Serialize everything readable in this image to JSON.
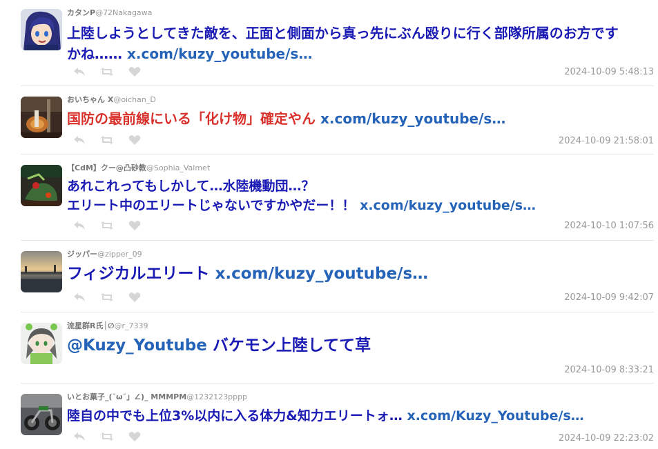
{
  "tweets": [
    {
      "name": "カタンP",
      "handle": "@72Nakagawa",
      "text": "上陸しようとしてきた敵を、正面と側面から真っ先にぶん殴りに行く部隊所属のお方です",
      "text2": "かね……",
      "link": "x.com/kuzy_youtube/s…",
      "timestamp": "2024-10-09 5:48:13"
    },
    {
      "name": "おいちゃん X",
      "handle": "@oichan_D",
      "text": "国防の最前線にいる「化け物」確定やん",
      "link": "x.com/kuzy_youtube/s…",
      "timestamp": "2024-10-09 21:58:01"
    },
    {
      "name": "【CdM】クー@凸砂教",
      "handle": "@Sophia_Valmet",
      "text": "あれこれってもしかして…水陸機動団…？",
      "text2": "エリート中のエリートじゃないですかやだー！！",
      "link": "x.com/kuzy_youtube/s…",
      "timestamp": "2024-10-10 1:07:56"
    },
    {
      "name": "ジッパー",
      "handle": "@zipper_09",
      "text": "フィジカルエリート",
      "link": "x.com/kuzy_youtube/s…",
      "timestamp": "2024-10-09 9:42:07"
    },
    {
      "name": "流星群R氏│∅",
      "handle": "@r_7339",
      "mention": "@Kuzy_Youtube",
      "text": "バケモン上陸してて草",
      "timestamp": "2024-10-09 8:33:21"
    },
    {
      "name": "いとお菓子_(˘ω˘」∠)_ MMMPM",
      "handle": "@1232123pppp",
      "text": "陸自の中でも上位3%以内に入る体力&知力エリートォ…",
      "link": "x.com/Kuzy_Youtube/s…",
      "timestamp": "2024-10-09 22:23:02"
    }
  ],
  "icons": [
    "reply-icon",
    "retweet-icon",
    "like-icon"
  ],
  "colors": {
    "text_blue": "#1a1ab4",
    "text_red": "#d9322d",
    "link": "#2563b8",
    "meta": "#999999",
    "icon": "#d6d6d6"
  }
}
